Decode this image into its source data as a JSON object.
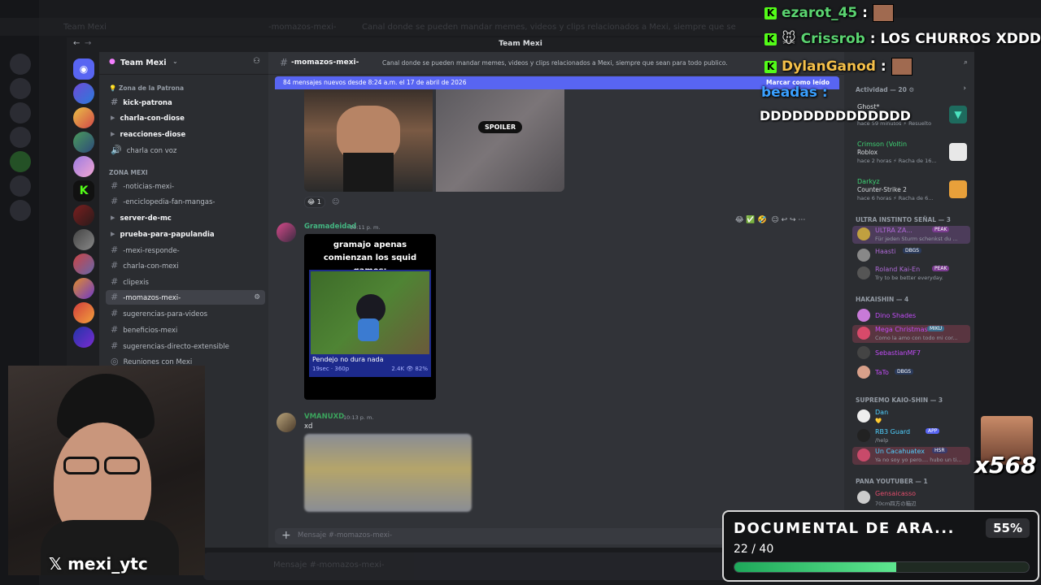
{
  "colors": {
    "discord_bg": "#313338",
    "sidebar_bg": "#2b2d31",
    "accent": "#5865f2",
    "kick_green": "#53fc18",
    "progress_green": "#3ed374"
  },
  "background": {
    "title": "Team Mexi",
    "channel": "-momazos-mexi-",
    "topic": "Canal donde se pueden mandar memes, videos y clips relacionados a Mexi, siempre que sean para todo publico.",
    "composer_placeholder": "Mensaje #",
    "composer_channel": "-momazos-mexi-"
  },
  "window": {
    "title": "Team Mexi"
  },
  "server": {
    "name": "Team Mexi"
  },
  "channels": {
    "category1": "Zona de la Patrona",
    "items1": [
      "kick-patrona",
      "charla-con-diose",
      "reacciones-diose",
      "charla con voz"
    ],
    "category2": "ZONA MEXI",
    "items2": [
      "-noticias-mexi-",
      "-enciclopedia-fan-mangas-",
      "server-de-mc",
      "prueba-para-papulandia",
      "-mexi-responde-",
      "charla-con-mexi",
      "clipexis",
      "-momazos-mexi-",
      "sugerencias-para-videos",
      "beneficios-mexi",
      "sugerencias-directo-extensible",
      "Reuniones con Mexi"
    ]
  },
  "main": {
    "channel_name": "-momazos-mexi-",
    "topic": "Canal donde se pueden mandar memes, videos y clips relacionados a Mexi, siempre que sean para todo publico.",
    "banner": "84 mensajes nuevos desde 8:24 a.m. el 17 de abril de 2026",
    "mark_read": "Marcar como leído",
    "spoiler": "SPOILER",
    "reaction_count": "1",
    "messages": [
      {
        "author": "Gramadeidad",
        "time": "10:11 p. m.",
        "meme_caption": "gramajo apenas comienzan los squid games:",
        "video_title": "Pendejo no dura nada",
        "video_meta": "19sec · 360p",
        "video_stats": "2.4K 👁 82%",
        "color": "#43b581"
      },
      {
        "author": "VMANUXD",
        "time": "10:13 p. m.",
        "text": "xd",
        "color": "#3ba55d"
      }
    ],
    "composer_placeholder": "Mensaje #",
    "composer_channel": "-momazos-mexi-"
  },
  "members": {
    "activity_label": "Actividad — 20",
    "activities": [
      {
        "name": "Ghost*",
        "game": "",
        "meta": "hace 59 minutos ⚡ Resuelto"
      },
      {
        "name": "Crimson (Voltin",
        "game": "Roblox",
        "meta": "hace 2 horas ⚡ Racha de 16..."
      },
      {
        "name": "Darkyz",
        "game": "Counter-Strike 2",
        "meta": "hace 6 horas ⚡ Racha de 6..."
      }
    ],
    "sections": [
      {
        "label": "ULTRA INSTINTO SEÑAL — 3",
        "members": [
          {
            "name": "ULTRA ZA...",
            "status": "Für jeden Sturm schenkst du ...",
            "badge": "PEAK",
            "color": "#b06ad8"
          },
          {
            "name": "Haasti",
            "status": "",
            "badge": "DBGS",
            "color": "#b06ad8"
          },
          {
            "name": "Roland Kai-En",
            "status": "Try to be better everyday.",
            "badge": "PEAK",
            "color": "#b06ad8"
          }
        ]
      },
      {
        "label": "HAKAISHIN — 4",
        "members": [
          {
            "name": "Dino Shades",
            "status": "",
            "badge": "",
            "color": "#c24cf6"
          },
          {
            "name": "Mega Christmas",
            "status": "Como la amo con todo mi cor...",
            "badge": "MIKU",
            "color": "#c24cf6"
          },
          {
            "name": "SebastianMF7",
            "status": "",
            "badge": "",
            "color": "#c24cf6"
          },
          {
            "name": "TaTo",
            "status": "",
            "badge": "DBGS",
            "color": "#c24cf6"
          }
        ]
      },
      {
        "label": "SUPREMO KAIO-SHIN — 3",
        "members": [
          {
            "name": "Dan",
            "status": "💛",
            "badge": "",
            "color": "#4fd0ff"
          },
          {
            "name": "RB3 Guard",
            "status": "/help",
            "badge": "APP",
            "color": "#4fd0ff"
          },
          {
            "name": "Un Cacahuatex",
            "status": "Ya no soy yo pero.... hubo un ti...",
            "badge": "HSR",
            "color": "#4fd0ff"
          }
        ]
      },
      {
        "label": "PANA YOUTUBER — 1",
        "members": [
          {
            "name": "Gensaicasso",
            "status": "70cm四方の箱辺",
            "badge": "",
            "color": "#e34d6c"
          }
        ]
      }
    ]
  },
  "chat_overlay": [
    {
      "user": "ezarot_45",
      "message": ""
    },
    {
      "user": "Crissrob",
      "message": "LOS CHURROS XDDDD"
    },
    {
      "user": "DylanGanod",
      "message": ""
    },
    {
      "user": "",
      "message": "beadas :"
    },
    {
      "user": "",
      "message": "DDDDDDDDDDDDDD"
    }
  ],
  "multiplier": "x568",
  "streamer": {
    "handle": "mexi_ytc"
  },
  "goal": {
    "title": "DOCUMENTAL DE ARA...",
    "percent_label": "55%",
    "count": "22 / 40",
    "fraction": 0.55
  }
}
